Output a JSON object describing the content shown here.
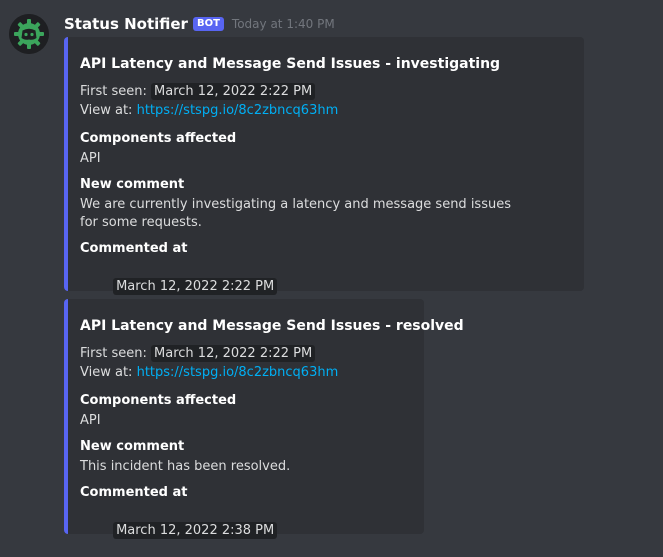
{
  "message": {
    "username": "Status Notifier",
    "bot_tag": "BOT",
    "timestamp": "Today at 1:40 PM",
    "avatar_icon": "discord-logo-icon",
    "colors": {
      "background": "#36393f",
      "embed_background": "#2f3136",
      "embed_accent": "#5865f2",
      "link": "#00aff4",
      "avatar_accent": "#3ba55c"
    }
  },
  "embeds": [
    {
      "title": "API Latency and Message Send Issues - investigating",
      "first_seen_label": "First seen:",
      "first_seen_value": "March 12, 2022 2:22 PM",
      "view_at_label": "View at:",
      "view_at_link": "https://stspg.io/8c2zbncq63hm",
      "components_label": "Components affected",
      "components_value": "API",
      "comment_label": "New comment",
      "comment_value": "We are currently investigating a latency and message send issues for some requests.",
      "commented_at_label": "Commented at",
      "commented_at_value": "March 12, 2022 2:22 PM"
    },
    {
      "title": "API Latency and Message Send Issues - resolved",
      "first_seen_label": "First seen:",
      "first_seen_value": "March 12, 2022 2:22 PM",
      "view_at_label": "View at:",
      "view_at_link": "https://stspg.io/8c2zbncq63hm",
      "components_label": "Components affected",
      "components_value": "API",
      "comment_label": "New comment",
      "comment_value": "This incident has been resolved.",
      "commented_at_label": "Commented at",
      "commented_at_value": "March 12, 2022 2:38 PM"
    }
  ]
}
